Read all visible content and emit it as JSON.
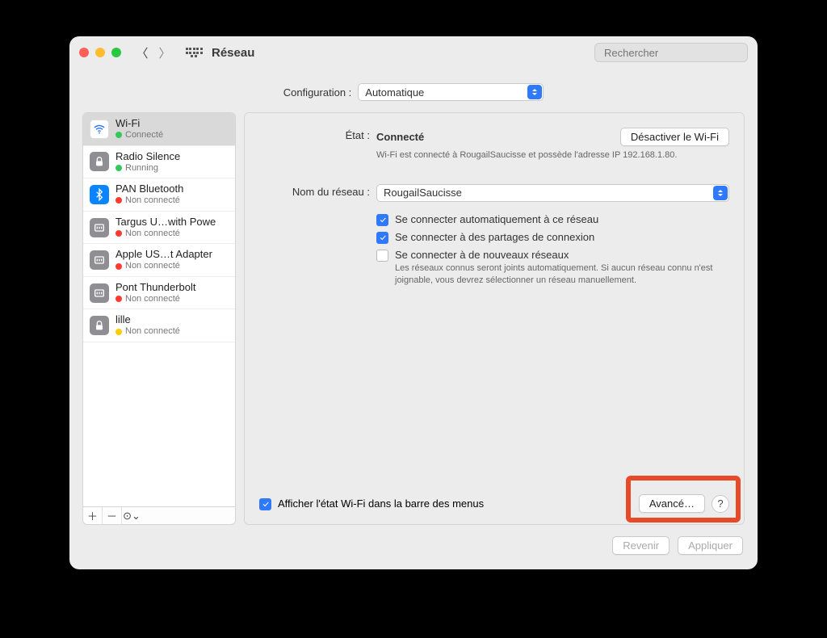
{
  "window": {
    "title": "Réseau",
    "search_placeholder": "Rechercher"
  },
  "config": {
    "label": "Configuration :",
    "value": "Automatique"
  },
  "sidebar": {
    "items": [
      {
        "name": "Wi-Fi",
        "status": "Connecté"
      },
      {
        "name": "Radio Silence",
        "status": "Running"
      },
      {
        "name": "PAN Bluetooth",
        "status": "Non connecté"
      },
      {
        "name": "Targus U…with Powe",
        "status": "Non connecté"
      },
      {
        "name": "Apple US…t Adapter",
        "status": "Non connecté"
      },
      {
        "name": "Pont Thunderbolt",
        "status": "Non connecté"
      },
      {
        "name": "lille",
        "status": "Non connecté"
      }
    ]
  },
  "main": {
    "state_label": "État :",
    "state_value": "Connecté",
    "state_desc": "Wi-Fi est connecté à RougailSaucisse et possède l'adresse IP 192.168.1.80.",
    "disable_btn": "Désactiver le Wi-Fi",
    "network_label": "Nom du réseau :",
    "network_value": "RougailSaucisse",
    "auto_connect": "Se connecter automatiquement à ce réseau",
    "hotspot": "Se connecter à des partages de connexion",
    "new_networks": "Se connecter à de nouveaux réseaux",
    "new_networks_note": "Les réseaux connus seront joints automatiquement. Si aucun réseau connu n'est joignable, vous devrez sélectionner un réseau manuellement.",
    "show_in_menu": "Afficher l'état Wi-Fi dans la barre des menus",
    "advanced_btn": "Avancé…"
  },
  "footer": {
    "revert": "Revenir",
    "apply": "Appliquer"
  }
}
